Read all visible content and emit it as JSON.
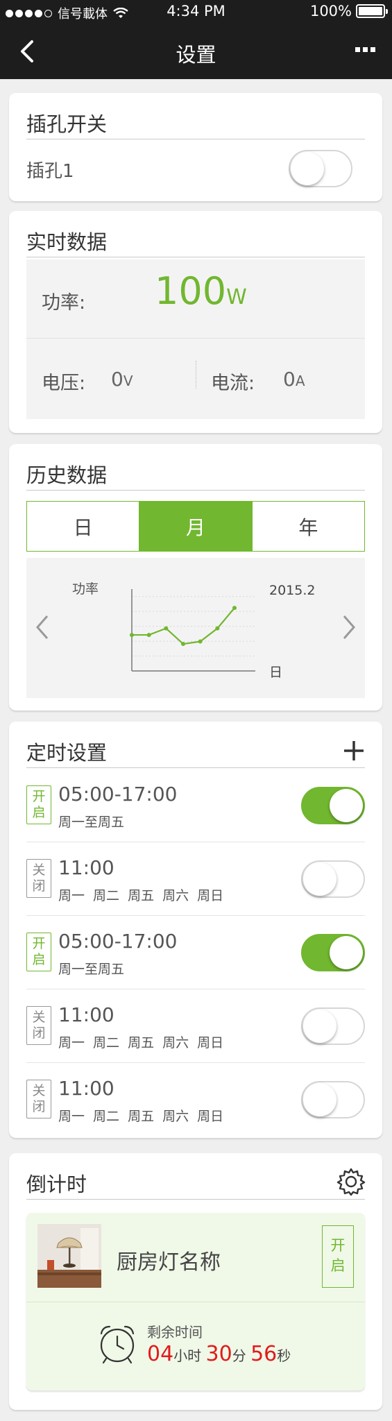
{
  "status_bar": {
    "carrier": "信号載体",
    "time": "4:34 PM",
    "battery": "100%"
  },
  "nav": {
    "title": "设置"
  },
  "socket_switch": {
    "title": "插孔开关",
    "item_label": "插孔1",
    "item_on": false
  },
  "realtime": {
    "title": "实时数据",
    "power_label": "功率:",
    "power_value": "100",
    "power_unit": "W",
    "voltage_label": "电压:",
    "voltage_value": "0",
    "voltage_unit": "V",
    "current_label": "电流:",
    "current_value": "0",
    "current_unit": "A"
  },
  "history": {
    "title": "历史数据",
    "tabs": [
      {
        "label": "日",
        "active": false
      },
      {
        "label": "月",
        "active": true
      },
      {
        "label": "年",
        "active": false
      }
    ],
    "period": "2015.2"
  },
  "chart_data": {
    "type": "line",
    "ylabel": "功率",
    "xlabel": "日",
    "values": [
      44,
      44,
      52,
      33,
      36,
      52,
      77
    ],
    "ylim": [
      0,
      100
    ],
    "color": "#71b72f"
  },
  "timers": {
    "title": "定时设置",
    "items": [
      {
        "badge": "开启",
        "on": true,
        "time": "05:00-17:00",
        "days": "周一至周五"
      },
      {
        "badge": "关闭",
        "on": false,
        "time": "11:00",
        "days": "周一 周二 周五 周六 周日"
      },
      {
        "badge": "开启",
        "on": true,
        "time": "05:00-17:00",
        "days": "周一至周五"
      },
      {
        "badge": "关闭",
        "on": false,
        "time": "11:00",
        "days": "周一 周二 周五 周六 周日"
      },
      {
        "badge": "关闭",
        "on": false,
        "time": "11:00",
        "days": "周一 周二 周五 周六 周日"
      }
    ]
  },
  "countdown": {
    "title": "倒计时",
    "device_name": "厨房灯名称",
    "button_label": "开启",
    "remaining_label": "剩余时间",
    "hours": "04",
    "hours_unit": "小时",
    "minutes": "30",
    "minutes_unit": "分",
    "seconds": "56",
    "seconds_unit": "秒"
  },
  "colors": {
    "accent": "#71b72f",
    "navbar": "#1d1d1d",
    "countdown_digits": "#e21b1b"
  }
}
